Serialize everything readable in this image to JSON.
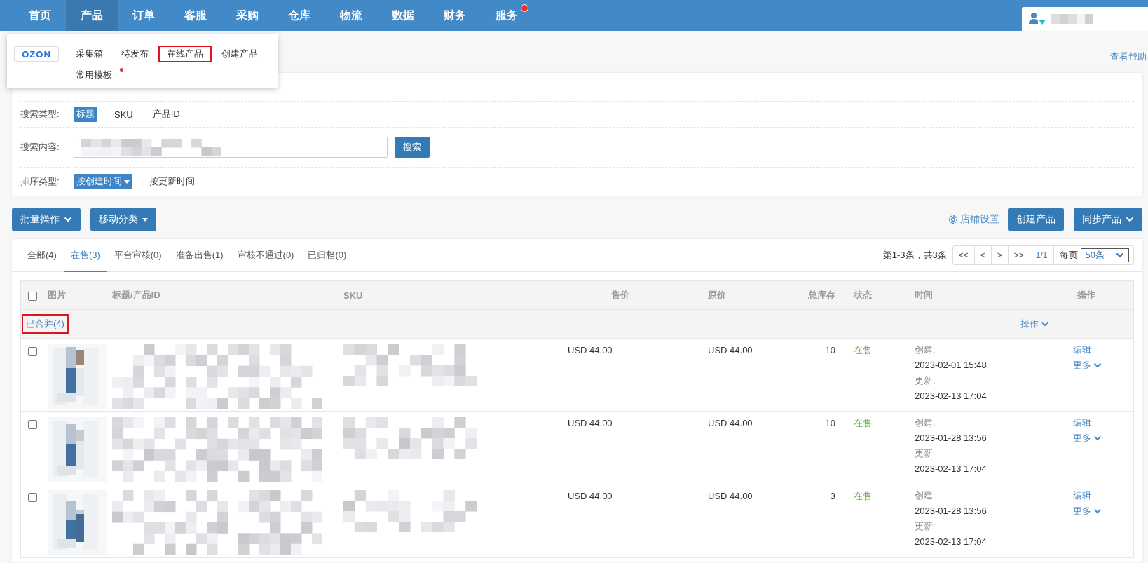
{
  "nav": {
    "items": [
      {
        "label": "首页",
        "selected": false,
        "notification": false
      },
      {
        "label": "产品",
        "selected": true,
        "notification": false
      },
      {
        "label": "订单",
        "selected": false,
        "notification": false
      },
      {
        "label": "客服",
        "selected": false,
        "notification": false
      },
      {
        "label": "采购",
        "selected": false,
        "notification": false
      },
      {
        "label": "仓库",
        "selected": false,
        "notification": false
      },
      {
        "label": "物流",
        "selected": false,
        "notification": false
      },
      {
        "label": "数据",
        "selected": false,
        "notification": false
      },
      {
        "label": "财务",
        "selected": false,
        "notification": false
      },
      {
        "label": "服务",
        "selected": false,
        "notification": true
      }
    ]
  },
  "dropdown": {
    "logo": "OZON",
    "items": [
      {
        "label": "采集箱",
        "highlighted": false,
        "notification": false
      },
      {
        "label": "待发布",
        "highlighted": false,
        "notification": false
      },
      {
        "label": "在线产品",
        "highlighted": true,
        "notification": false
      },
      {
        "label": "创建产品",
        "highlighted": false,
        "notification": false
      },
      {
        "label": "常用模板",
        "highlighted": false,
        "notification": true
      }
    ]
  },
  "help_link": "查看帮助",
  "filters": {
    "search_type": {
      "label": "搜索类型:",
      "options": [
        {
          "label": "标题",
          "selected": true
        },
        {
          "label": "SKU",
          "selected": false
        },
        {
          "label": "产品ID",
          "selected": false
        }
      ]
    },
    "search_content": {
      "label": "搜索内容:",
      "button": "搜索"
    },
    "sort_type": {
      "label": "排序类型:",
      "options": [
        {
          "label": "按创建时间",
          "selected": true
        },
        {
          "label": "按更新时间",
          "selected": false
        }
      ]
    }
  },
  "actions": {
    "left": [
      {
        "label": "批量操作",
        "kind": "chevron"
      },
      {
        "label": "移动分类",
        "kind": "triangle"
      }
    ],
    "settings_link": "店铺设置",
    "right": [
      {
        "label": "创建产品",
        "kind": "plain"
      },
      {
        "label": "同步产品",
        "kind": "chevron"
      }
    ]
  },
  "tabs": [
    {
      "label": "全部(4)",
      "selected": false
    },
    {
      "label": "在售(3)",
      "selected": true
    },
    {
      "label": "平台审核(0)",
      "selected": false
    },
    {
      "label": "准备出售(1)",
      "selected": false
    },
    {
      "label": "审核不通过(0)",
      "selected": false
    },
    {
      "label": "已归档(0)",
      "selected": false
    }
  ],
  "pagination": {
    "summary": "第1-3条，共3条",
    "buttons": [
      "<<",
      "<",
      ">",
      ">>"
    ],
    "page": "1/1",
    "per_page_label": "每页",
    "per_page": "50条"
  },
  "table": {
    "select_all_checked": false,
    "columns": [
      "图片",
      "标题/产品ID",
      "SKU",
      "售价",
      "原价",
      "总库存",
      "状态",
      "时间",
      "操作"
    ],
    "group": {
      "label": "已合并(4)",
      "highlighted": true,
      "action": "操作"
    },
    "rows": [
      {
        "checked": false,
        "price": "USD 44.00",
        "original_price": "USD 44.00",
        "stock": "10",
        "status": "在售",
        "created_label": "创建:",
        "created": "2023-02-01 15:48",
        "updated_label": "更新:",
        "updated": "2023-02-13 17:04",
        "edit": "编辑",
        "more": "更多"
      },
      {
        "checked": false,
        "price": "USD 44.00",
        "original_price": "USD 44.00",
        "stock": "10",
        "status": "在售",
        "created_label": "创建:",
        "created": "2023-01-28 13:56",
        "updated_label": "更新:",
        "updated": "2023-02-13 17:04",
        "edit": "编辑",
        "more": "更多"
      },
      {
        "checked": false,
        "price": "USD 44.00",
        "original_price": "USD 44.00",
        "stock": "3",
        "status": "在售",
        "created_label": "创建:",
        "created": "2023-01-28 13:56",
        "updated_label": "更新:",
        "updated": "2023-02-13 17:04",
        "edit": "编辑",
        "more": "更多"
      }
    ]
  }
}
